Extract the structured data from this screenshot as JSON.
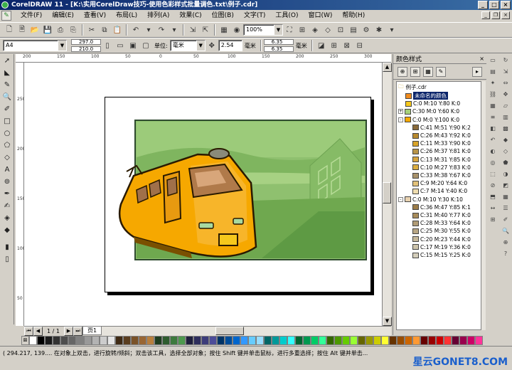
{
  "titlebar": {
    "text": "CorelDRAW 11 - [K:\\实用CorelDraw技巧-使用色彩样式批量调色.txt\\例子.cdr]",
    "min": "_",
    "max": "□",
    "close": "×"
  },
  "menubar": {
    "items": [
      "文件(F)",
      "编辑(E)",
      "查看(V)",
      "布局(L)",
      "排列(A)",
      "效果(C)",
      "位图(B)",
      "文字(T)",
      "工具(O)",
      "窗口(W)",
      "帮助(H)"
    ]
  },
  "toolbar1": {
    "zoom": "100%"
  },
  "toolbar2": {
    "paper": "A4",
    "width": "297.0",
    "height": "210.0",
    "units_label": "单位:",
    "units": "毫米",
    "nudge": "2.54",
    "nudge_unit": "毫米",
    "dup_x": "6.35",
    "dup_y": "6.35",
    "dup_unit": "毫米"
  },
  "rulers": {
    "horizontal": [
      "200",
      "150",
      "100",
      "50",
      "0",
      "50",
      "100",
      "150",
      "200",
      "250",
      "300"
    ],
    "vertical": [
      "250",
      "200",
      "150",
      "100",
      "50"
    ]
  },
  "pagenav": {
    "count": "1 / 1",
    "tab": "页1"
  },
  "docker": {
    "title": "颜色样式",
    "close": "×",
    "file": "例子.cdr",
    "items": [
      {
        "label": "未命名的颜色",
        "color": "#f28c1e",
        "level": 1,
        "selected": true
      },
      {
        "label": "C:0 M:10 Y:80 K:0",
        "color": "#f6c81c",
        "level": 1
      },
      {
        "label": "C:30 M:0 Y:60 K:0",
        "color": "#a6d07a",
        "level": 1,
        "expander": "+"
      },
      {
        "label": "C:0 M:0 Y:100 K:0",
        "color": "#f6a800",
        "level": 1,
        "expander": "-"
      },
      {
        "label": "C:41 M:51 Y:90 K:2",
        "color": "#8a6a3a",
        "level": 2
      },
      {
        "label": "C:26 M:43 Y:92 K:0",
        "color": "#b88a2e",
        "level": 2
      },
      {
        "label": "C:11 M:33 Y:90 K:0",
        "color": "#d8a42a",
        "level": 2
      },
      {
        "label": "C:26 M:37 Y:81 K:0",
        "color": "#b89448",
        "level": 2
      },
      {
        "label": "C:13 M:31 Y:85 K:0",
        "color": "#d6a43e",
        "level": 2
      },
      {
        "label": "C:10 M:27 Y:83 K:0",
        "color": "#dcae40",
        "level": 2
      },
      {
        "label": "C:33 M:38 Y:67 K:0",
        "color": "#a8926a",
        "level": 2
      },
      {
        "label": "C:9 M:20 Y:64 K:0",
        "color": "#e2c27a",
        "level": 2
      },
      {
        "label": "C:7 M:14 Y:40 K:0",
        "color": "#eedcae",
        "level": 2
      },
      {
        "label": "C:0 M:10 Y:30 K:10",
        "color": "#e8d2b0",
        "level": 1,
        "expander": "-"
      },
      {
        "label": "C:36 M:47 Y:85 K:1",
        "color": "#9c7c48",
        "level": 2
      },
      {
        "label": "C:31 M:40 Y:77 K:0",
        "color": "#a88c5a",
        "level": 2
      },
      {
        "label": "C:28 M:33 Y:64 K:0",
        "color": "#b09c76",
        "level": 2
      },
      {
        "label": "C:25 M:30 Y:55 K:0",
        "color": "#b8a684",
        "level": 2
      },
      {
        "label": "C:20 M:23 Y:44 K:0",
        "color": "#c6b89a",
        "level": 2
      },
      {
        "label": "C:17 M:19 Y:36 K:0",
        "color": "#cec4aa",
        "level": 2
      },
      {
        "label": "C:15 M:15 Y:25 K:0",
        "color": "#d4ceba",
        "level": 2
      }
    ]
  },
  "palette": [
    "#ffffff",
    "#000000",
    "#1a1a1a",
    "#333333",
    "#4d4d4d",
    "#666666",
    "#808080",
    "#999999",
    "#b3b3b3",
    "#cccccc",
    "#e6e6e6",
    "#3f2a14",
    "#5a3d1e",
    "#7a5228",
    "#996633",
    "#b87f3d",
    "#1f3d1f",
    "#2e5c2e",
    "#3d7a3d",
    "#4d994d",
    "#1f1f3d",
    "#2e2e5c",
    "#3d3d7a",
    "#4d4d99",
    "#003366",
    "#004d99",
    "#0066cc",
    "#3399ff",
    "#66ccff",
    "#99ddff",
    "#006666",
    "#009999",
    "#00cccc",
    "#33ffff",
    "#006633",
    "#009950",
    "#00cc66",
    "#33ff99",
    "#336600",
    "#4d9900",
    "#66cc00",
    "#99ff33",
    "#666600",
    "#999900",
    "#cccc00",
    "#ffff33",
    "#663300",
    "#994d00",
    "#cc6600",
    "#ff9933",
    "#660000",
    "#990000",
    "#cc0000",
    "#ff3333",
    "#660033",
    "#99004d",
    "#cc0066",
    "#ff3399"
  ],
  "status": {
    "text": "( 294.217, 139.... 在对象上双击，进行旋转/倾斜；双击该工具，选择全部对象；按住 Shift 键并单击鼠标，进行多重选择；按住 Alt 键并单击...",
    "watermark": "星云GONET8.COM"
  }
}
